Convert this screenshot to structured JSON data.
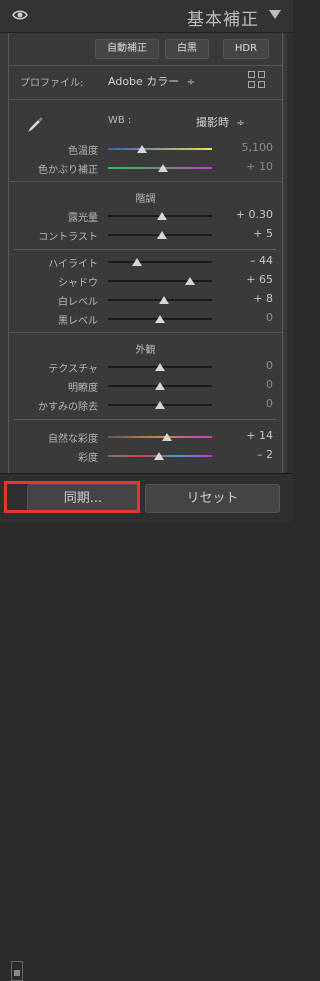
{
  "header": {
    "title": "基本補正"
  },
  "top_buttons": {
    "auto": "自動補正",
    "bw": "白黒",
    "hdr": "HDR"
  },
  "profile": {
    "label": "プロファイル:",
    "value": "Adobe カラー",
    "chevron": "÷"
  },
  "wb": {
    "label": "WB :",
    "value": "撮影時",
    "chevron": "÷"
  },
  "sliders_wb": [
    {
      "label": "色温度",
      "value": "5,100",
      "dim": true,
      "pos": 0.33,
      "track": "temp"
    },
    {
      "label": "色かぶり補正",
      "value": "+ 10",
      "dim": true,
      "pos": 0.53,
      "track": "tint"
    }
  ],
  "tone": {
    "title": "階調",
    "sliders": [
      {
        "label": "露光量",
        "value": "+ 0.30",
        "dim": false,
        "pos": 0.52
      },
      {
        "label": "コントラスト",
        "value": "+ 5",
        "dim": false,
        "pos": 0.52
      }
    ]
  },
  "tone2": {
    "sliders": [
      {
        "label": "ハイライト",
        "value": "– 44",
        "dim": false,
        "pos": 0.28
      },
      {
        "label": "シャドウ",
        "value": "+ 65",
        "dim": false,
        "pos": 0.79
      },
      {
        "label": "白レベル",
        "value": "+ 8",
        "dim": false,
        "pos": 0.54
      },
      {
        "label": "黒レベル",
        "value": "0",
        "dim": true,
        "pos": 0.5
      }
    ]
  },
  "presence": {
    "title": "外観",
    "sliders": [
      {
        "label": "テクスチャ",
        "value": "0",
        "dim": true,
        "pos": 0.5
      },
      {
        "label": "明瞭度",
        "value": "0",
        "dim": true,
        "pos": 0.5
      },
      {
        "label": "かすみの除去",
        "value": "0",
        "dim": true,
        "pos": 0.5
      }
    ]
  },
  "color": {
    "sliders": [
      {
        "label": "自然な彩度",
        "value": "+ 14",
        "dim": false,
        "pos": 0.57,
        "track": "vib"
      },
      {
        "label": "彩度",
        "value": "– 2",
        "dim": false,
        "pos": 0.49,
        "track": "sat"
      }
    ]
  },
  "bottom": {
    "sync": "同期...",
    "reset": "リセット"
  },
  "colors": {
    "highlight": "#e03a2a"
  }
}
